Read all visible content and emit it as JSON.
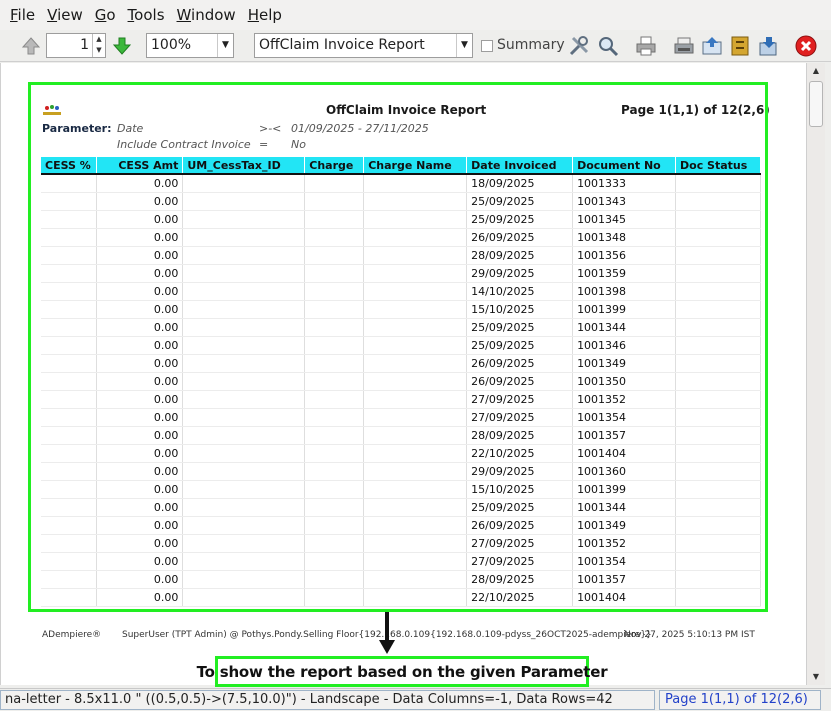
{
  "menu": [
    {
      "label": "File",
      "key": "F",
      "rest": "ile"
    },
    {
      "label": "View",
      "key": "V",
      "rest": "iew"
    },
    {
      "label": "Go",
      "key": "G",
      "rest": "o"
    },
    {
      "label": "Tools",
      "key": "T",
      "rest": "ools"
    },
    {
      "label": "Window",
      "key": "W",
      "rest": "indow"
    },
    {
      "label": "Help",
      "key": "H",
      "rest": "elp"
    }
  ],
  "toolbar": {
    "page_number": "1",
    "zoom": "100%",
    "report_select": "OffClaim Invoice Report",
    "summary_label": "Summary",
    "colors": {
      "green_frame": "#22ee22",
      "header_bg": "#22e5f5",
      "close_red": "#e02020"
    }
  },
  "report": {
    "title": "OffClaim Invoice Report",
    "page_info": "Page 1(1,1) of 12(2,6)",
    "parameter_label": "Parameter:",
    "parameters": [
      {
        "name": "Date",
        "op": ">-<",
        "value": "01/09/2025 - 27/11/2025"
      },
      {
        "name": "Include Contract Invoice",
        "op": "=",
        "value": "No"
      }
    ],
    "columns": [
      "CESS %",
      "CESS Amt",
      "UM_CessTax_ID",
      "Charge",
      "Charge Name",
      "Date Invoiced",
      "Document No",
      "Doc Status"
    ],
    "rows": [
      {
        "cess_amt": "0.00",
        "date": "18/09/2025",
        "doc": "1001333"
      },
      {
        "cess_amt": "0.00",
        "date": "25/09/2025",
        "doc": "1001343"
      },
      {
        "cess_amt": "0.00",
        "date": "25/09/2025",
        "doc": "1001345"
      },
      {
        "cess_amt": "0.00",
        "date": "26/09/2025",
        "doc": "1001348"
      },
      {
        "cess_amt": "0.00",
        "date": "28/09/2025",
        "doc": "1001356"
      },
      {
        "cess_amt": "0.00",
        "date": "29/09/2025",
        "doc": "1001359"
      },
      {
        "cess_amt": "0.00",
        "date": "14/10/2025",
        "doc": "1001398"
      },
      {
        "cess_amt": "0.00",
        "date": "15/10/2025",
        "doc": "1001399"
      },
      {
        "cess_amt": "0.00",
        "date": "25/09/2025",
        "doc": "1001344"
      },
      {
        "cess_amt": "0.00",
        "date": "25/09/2025",
        "doc": "1001346"
      },
      {
        "cess_amt": "0.00",
        "date": "26/09/2025",
        "doc": "1001349"
      },
      {
        "cess_amt": "0.00",
        "date": "26/09/2025",
        "doc": "1001350"
      },
      {
        "cess_amt": "0.00",
        "date": "27/09/2025",
        "doc": "1001352"
      },
      {
        "cess_amt": "0.00",
        "date": "27/09/2025",
        "doc": "1001354"
      },
      {
        "cess_amt": "0.00",
        "date": "28/09/2025",
        "doc": "1001357"
      },
      {
        "cess_amt": "0.00",
        "date": "22/10/2025",
        "doc": "1001404"
      },
      {
        "cess_amt": "0.00",
        "date": "29/09/2025",
        "doc": "1001360"
      },
      {
        "cess_amt": "0.00",
        "date": "15/10/2025",
        "doc": "1001399"
      },
      {
        "cess_amt": "0.00",
        "date": "25/09/2025",
        "doc": "1001344"
      },
      {
        "cess_amt": "0.00",
        "date": "26/09/2025",
        "doc": "1001349"
      },
      {
        "cess_amt": "0.00",
        "date": "27/09/2025",
        "doc": "1001352"
      },
      {
        "cess_amt": "0.00",
        "date": "27/09/2025",
        "doc": "1001354"
      },
      {
        "cess_amt": "0.00",
        "date": "28/09/2025",
        "doc": "1001357"
      },
      {
        "cess_amt": "0.00",
        "date": "22/10/2025",
        "doc": "1001404"
      }
    ],
    "footer": {
      "brand": "ADempiere®",
      "user": "SuperUser (TPT Admin) @ Pothys.Pondy.Selling Floor{192.168.0.109{192.168.0.109-pdyss_26OCT2025-adempiere}}",
      "timestamp": "Nov 27, 2025 5:10:13 PM IST"
    }
  },
  "annotation": {
    "text": "To show the report based on the given Parameter"
  },
  "status": {
    "left": "na-letter - 8.5x11.0 \" ((0.5,0.5)->(7.5,10.0)\") - Landscape - Data Columns=-1, Data Rows=42",
    "right": "Page 1(1,1) of 12(2,6)"
  }
}
